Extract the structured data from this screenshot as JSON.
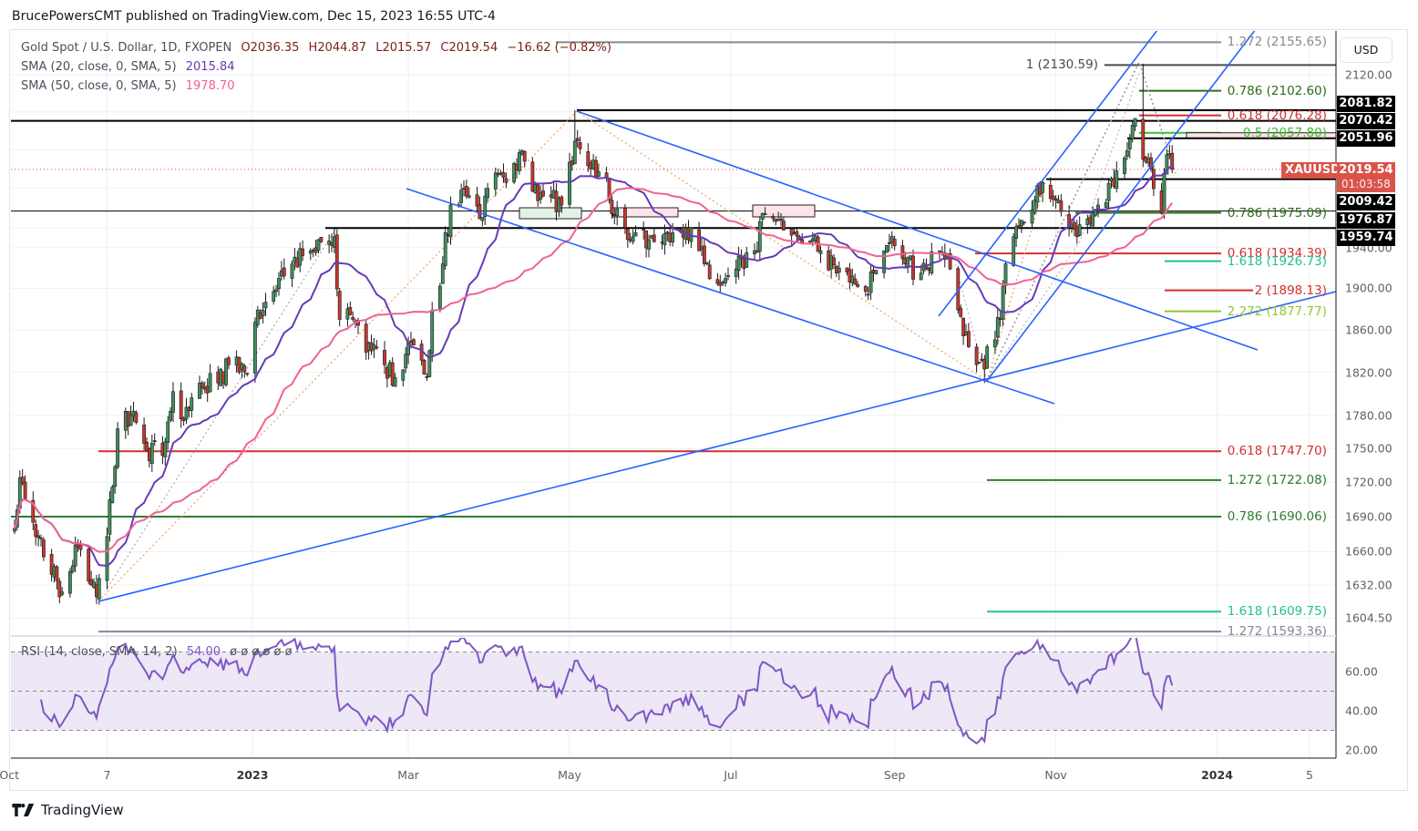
{
  "publisher": "BrucePowersCMT published on TradingView.com, Dec 15, 2023 16:55 UTC-4",
  "legend": {
    "symbol": "Gold Spot / U.S. Dollar, 1D, FXOPEN",
    "open": "O2036.35",
    "high": "H2044.87",
    "low": "L2015.57",
    "close": "C2019.54",
    "change": "−16.62 (−0.82%)",
    "sma20_label": "SMA (20, close, 0, SMA, 5)",
    "sma20_value": "2015.84",
    "sma50_label": "SMA (50, close, 0, SMA, 5)",
    "sma50_value": "1978.70",
    "rsi_label": "RSI (14, close, SMA, 14, 2)",
    "rsi_value": "54.00",
    "rsi_na": "ø  ø  ø  ø  ø  ø"
  },
  "axis": {
    "currency": "USD",
    "symbol_tag": "XAUUSD",
    "last_price": "2019.54",
    "countdown": "01:03:58",
    "price_ticks": [
      "2120.00",
      "1940.00",
      "1900.00",
      "1860.00",
      "1820.00",
      "1780.00",
      "1750.00",
      "1720.00",
      "1690.00",
      "1660.00",
      "1632.00",
      "1604.50"
    ],
    "rsi_ticks": [
      "60.00",
      "40.00",
      "20.00"
    ],
    "time_ticks": [
      {
        "label": "Oct",
        "date": "2022-10-01",
        "bold": false
      },
      {
        "label": "7",
        "date": "2022-11-07",
        "bold": false
      },
      {
        "label": "2023",
        "date": "2023-01-01",
        "bold": true
      },
      {
        "label": "Mar",
        "date": "2023-03-01",
        "bold": false
      },
      {
        "label": "May",
        "date": "2023-05-01",
        "bold": false
      },
      {
        "label": "Jul",
        "date": "2023-07-01",
        "bold": false
      },
      {
        "label": "Sep",
        "date": "2023-09-01",
        "bold": false
      },
      {
        "label": "Nov",
        "date": "2023-11-01",
        "bold": false
      },
      {
        "label": "2024",
        "date": "2024-01-01",
        "bold": true
      },
      {
        "label": "5",
        "date": "2024-02-05",
        "bold": false
      }
    ],
    "price_tags": [
      "2081.82",
      "2070.42",
      "2051.96",
      "2009.42",
      "1976.87",
      "1959.74"
    ]
  },
  "branding": "TradingView",
  "colors": {
    "up": "#3f8f5e",
    "down": "#c8372d",
    "sma20": "#673ab7",
    "sma50": "#f06292",
    "rsi": "#7e57c2",
    "rsi_band": "#ede7f6",
    "trendline": "#2962ff",
    "last_price": "#d9534a"
  },
  "chart_data": {
    "type": "candlestick",
    "symbol": "XAUUSD",
    "interval": "1D",
    "y_scale": "log",
    "ylim": [
      1585,
      2175
    ],
    "grid": true,
    "last_bar": {
      "date": "2023-12-15",
      "open": 2036.35,
      "high": 2044.87,
      "low": 2015.57,
      "close": 2019.54
    },
    "close_path": [
      [
        "2022-10-03",
        1680
      ],
      [
        "2022-10-05",
        1724
      ],
      [
        "2022-10-11",
        1673
      ],
      [
        "2022-10-21",
        1626
      ],
      [
        "2022-10-27",
        1664
      ],
      [
        "2022-11-03",
        1622,
        null,
        1616
      ],
      [
        "2022-11-07",
        1673
      ],
      [
        "2022-11-11",
        1768
      ],
      [
        "2022-11-16",
        1781
      ],
      [
        "2022-11-22",
        1748
      ],
      [
        "2022-11-28",
        1744
      ],
      [
        "2022-12-02",
        1802
      ],
      [
        "2022-12-05",
        1777
      ],
      [
        "2022-12-12",
        1810
      ],
      [
        "2022-12-19",
        1810
      ],
      [
        "2022-12-23",
        1827
      ],
      [
        "2022-12-30",
        1819
      ],
      [
        "2023-01-03",
        1879
      ],
      [
        "2023-01-09",
        1897
      ],
      [
        "2023-01-16",
        1924
      ],
      [
        "2023-01-23",
        1937
      ],
      [
        "2023-01-27",
        1946
      ],
      [
        "2023-02-01",
        1951,
        1959
      ],
      [
        "2023-02-03",
        1870
      ],
      [
        "2023-02-08",
        1870
      ],
      [
        "2023-02-15",
        1840
      ],
      [
        "2023-02-20",
        1827
      ],
      [
        "2023-02-24",
        1815,
        null,
        1808
      ],
      [
        "2023-03-02",
        1849
      ],
      [
        "2023-03-08",
        1815
      ],
      [
        "2023-03-10",
        1879
      ],
      [
        "2023-03-14",
        1924
      ],
      [
        "2023-03-17",
        1983
      ],
      [
        "2023-03-23",
        1992
      ],
      [
        "2023-03-28",
        1969
      ],
      [
        "2023-04-03",
        2016
      ],
      [
        "2023-04-07",
        2006
      ],
      [
        "2023-04-13",
        2039
      ],
      [
        "2023-04-17",
        1997
      ],
      [
        "2023-04-21",
        1992
      ],
      [
        "2023-04-28",
        1983
      ],
      [
        "2023-05-03",
        2049,
        2081.82
      ],
      [
        "2023-05-09",
        2020
      ],
      [
        "2023-05-15",
        2011
      ],
      [
        "2023-05-17",
        1974
      ],
      [
        "2023-05-22",
        1960
      ],
      [
        "2023-05-26",
        1955
      ],
      [
        "2023-06-02",
        1946
      ],
      [
        "2023-06-09",
        1955
      ],
      [
        "2023-06-16",
        1960
      ],
      [
        "2023-06-21",
        1924
      ],
      [
        "2023-06-28",
        1906
      ],
      [
        "2023-07-03",
        1919
      ],
      [
        "2023-07-10",
        1937
      ],
      [
        "2023-07-14",
        1974
      ],
      [
        "2023-07-20",
        1969
      ],
      [
        "2023-07-25",
        1955
      ],
      [
        "2023-07-31",
        1946
      ],
      [
        "2023-08-04",
        1937
      ],
      [
        "2023-08-10",
        1915
      ],
      [
        "2023-08-15",
        1906
      ],
      [
        "2023-08-21",
        1897
      ],
      [
        "2023-08-24",
        1915
      ],
      [
        "2023-08-28",
        1937
      ],
      [
        "2023-09-01",
        1942
      ],
      [
        "2023-09-05",
        1924
      ],
      [
        "2023-09-11",
        1915
      ],
      [
        "2023-09-13",
        1919
      ],
      [
        "2023-09-18",
        1937
      ],
      [
        "2023-09-22",
        1919
      ],
      [
        "2023-09-25",
        1879
      ],
      [
        "2023-09-29",
        1844
      ],
      [
        "2023-10-02",
        1827
      ],
      [
        "2023-10-05",
        1823,
        null,
        1810
      ],
      [
        "2023-10-06",
        1844
      ],
      [
        "2023-10-11",
        1870
      ],
      [
        "2023-10-13",
        1924
      ],
      [
        "2023-10-18",
        1960
      ],
      [
        "2023-10-23",
        1978
      ],
      [
        "2023-10-27",
        2006,
        2009.42
      ],
      [
        "2023-11-01",
        1988
      ],
      [
        "2023-11-06",
        1960
      ],
      [
        "2023-11-09",
        1951
      ],
      [
        "2023-11-13",
        1969
      ],
      [
        "2023-11-17",
        1983
      ],
      [
        "2023-11-23",
        2002
      ],
      [
        "2023-11-28",
        2039
      ],
      [
        "2023-12-01",
        2073
      ],
      [
        "2023-12-04",
        2030,
        2132
      ],
      [
        "2023-12-07",
        2020
      ],
      [
        "2023-12-11",
        1975,
        null,
        1973
      ],
      [
        "2023-12-13",
        2035
      ],
      [
        "2023-12-14",
        2036
      ]
    ],
    "levels": [
      {
        "label": "1.272 (2155.65)",
        "price": 2155.65,
        "color": "#868993"
      },
      {
        "label": "1 (2130.59)",
        "price": 2130.59,
        "color": "#4a4a4a"
      },
      {
        "label": "0.786 (2102.60)",
        "price": 2102.6,
        "color": "#2e6b1a"
      },
      {
        "label": "0.618 (2076.28)",
        "price": 2076.28,
        "color": "#d32f2f"
      },
      {
        "label": "0.5 (2057.80)",
        "price": 2057.8,
        "color": "#3cbf2e"
      },
      {
        "label": "0.786 (1975.09)",
        "price": 1975.09,
        "color": "#2e6b1a"
      },
      {
        "label": "0.618 (1934.39)",
        "price": 1934.39,
        "color": "#d32f2f"
      },
      {
        "label": "1.618 (1926.73)",
        "price": 1926.73,
        "color": "#22c38e"
      },
      {
        "label": "2 (1898.13)",
        "price": 1898.13,
        "color": "#d32f2f"
      },
      {
        "label": "2.272 (1877.77)",
        "price": 1877.77,
        "color": "#8cc832"
      },
      {
        "label": "0.618 (1747.70)",
        "price": 1747.7,
        "color": "#d32f2f"
      },
      {
        "label": "1.272 (1722.08)",
        "price": 1722.08,
        "color": "#2e7d32"
      },
      {
        "label": "0.786 (1690.06)",
        "price": 1690.06,
        "color": "#2e7d32"
      },
      {
        "label": "1.618 (1609.75)",
        "price": 1609.75,
        "color": "#22c38e"
      },
      {
        "label": "1.272 (1593.36)",
        "price": 1593.36,
        "color": "#868993"
      }
    ],
    "horizontal_lines": [
      2081.82,
      2070.42,
      2051.96,
      2009.42,
      1976.87,
      1959.74
    ],
    "rsi": {
      "period": 14,
      "last": 54.0,
      "bands": [
        70,
        50,
        30
      ],
      "ylim": [
        15,
        85
      ]
    }
  }
}
